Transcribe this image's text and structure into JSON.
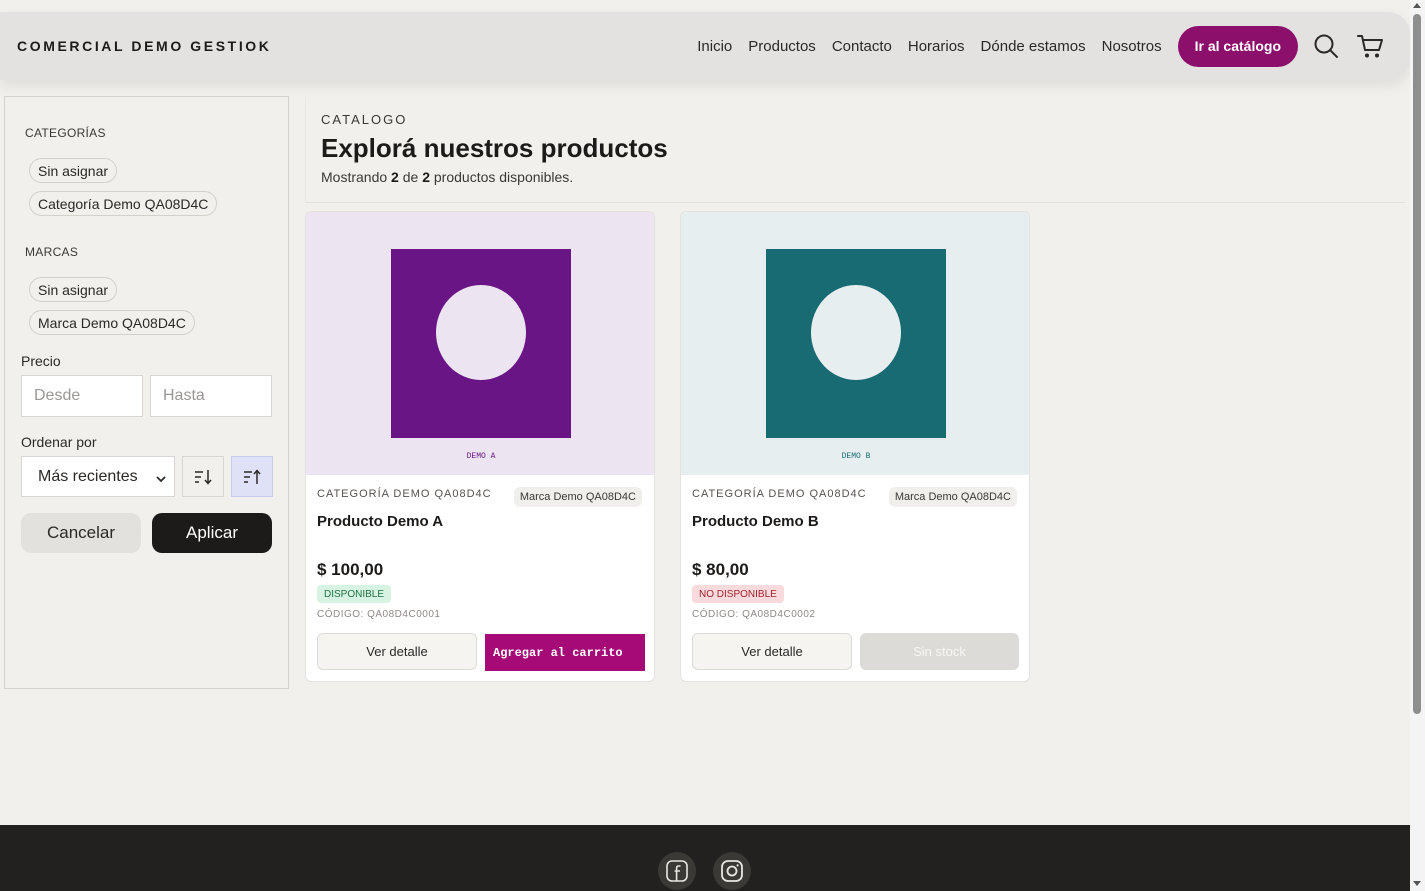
{
  "header": {
    "brand": "COMERCIAL DEMO GESTIOK",
    "nav": [
      "Inicio",
      "Productos",
      "Contacto",
      "Horarios",
      "Dónde estamos",
      "Nosotros"
    ],
    "cta": "Ir al catálogo",
    "icons": [
      "search-icon",
      "cart-icon"
    ]
  },
  "sidebar": {
    "categories_label": "CATEGORÍAS",
    "categories": [
      "Sin asignar",
      "Categoría Demo QA08D4C"
    ],
    "brands_label": "MARCAS",
    "brands": [
      "Sin asignar",
      "Marca Demo QA08D4C"
    ],
    "price_label": "Precio",
    "price_from_placeholder": "Desde",
    "price_to_placeholder": "Hasta",
    "sort_label": "Ordenar por",
    "sort_value": "Más recientes",
    "cancel": "Cancelar",
    "apply": "Aplicar"
  },
  "main": {
    "eyebrow": "CATALOGO",
    "title": "Explorá nuestros productos",
    "summary": {
      "prefix": "Mostrando",
      "shown": "2",
      "middle": "de",
      "total": "2",
      "suffix": "productos disponibles."
    }
  },
  "products": [
    {
      "image_tag": "DEMO A",
      "image_bg": "#ede4f2",
      "image_color": "#6a1585",
      "category": "CATEGORÍA DEMO QA08D4C",
      "brand": "Marca Demo QA08D4C",
      "name": "Producto Demo A",
      "price": "$ 100,00",
      "status": "DISPONIBLE",
      "code": "CÓDIGO: QA08D4C0001",
      "detail": "Ver detalle",
      "action": "Agregar al carrito"
    },
    {
      "image_tag": "DEMO B",
      "image_bg": "#e6eef0",
      "image_color": "#196b73",
      "category": "CATEGORÍA DEMO QA08D4C",
      "brand": "Marca Demo QA08D4C",
      "name": "Producto Demo B",
      "price": "$ 80,00",
      "status": "NO DISPONIBLE",
      "code": "CÓDIGO: QA08D4C0002",
      "detail": "Ver detalle",
      "action": "Sin stock"
    }
  ],
  "footer": {
    "social_icons": [
      "facebook-icon",
      "instagram-icon"
    ]
  },
  "colors": {
    "accent": "#8c0f6b",
    "cart_button": "#a50a76",
    "dark": "#1d1b1a",
    "page_bg": "#f2f0ec"
  }
}
